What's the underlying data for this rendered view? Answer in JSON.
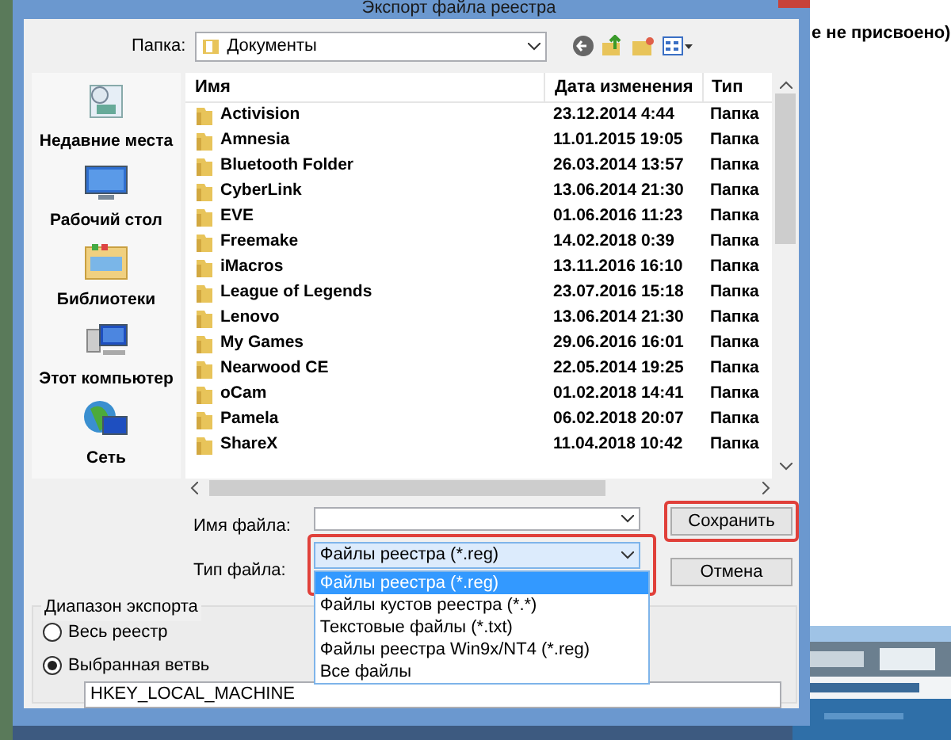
{
  "window": {
    "title": "Экспорт файла реестра"
  },
  "background_window": {
    "text": "е не присвоено)"
  },
  "folder": {
    "label": "Папка:",
    "value": "Документы"
  },
  "places": [
    {
      "kind": "recent",
      "label": "Недавние места"
    },
    {
      "kind": "desktop",
      "label": "Рабочий стол"
    },
    {
      "kind": "libraries",
      "label": "Библиотеки"
    },
    {
      "kind": "computer",
      "label": "Этот компьютер"
    },
    {
      "kind": "network",
      "label": "Сеть"
    }
  ],
  "table": {
    "columns": [
      "Имя",
      "Дата изменения",
      "Тип"
    ],
    "rows": [
      [
        "Activision",
        "23.12.2014 4:44",
        "Папка"
      ],
      [
        "Amnesia",
        "11.01.2015 19:05",
        "Папка"
      ],
      [
        "Bluetooth Folder",
        "26.03.2014 13:57",
        "Папка"
      ],
      [
        "CyberLink",
        "13.06.2014 21:30",
        "Папка"
      ],
      [
        "EVE",
        "01.06.2016 11:23",
        "Папка"
      ],
      [
        "Freemake",
        "14.02.2018 0:39",
        "Папка"
      ],
      [
        "iMacros",
        "13.11.2016 16:10",
        "Папка"
      ],
      [
        "League of Legends",
        "23.07.2016 15:18",
        "Папка"
      ],
      [
        "Lenovo",
        "13.06.2014 21:30",
        "Папка"
      ],
      [
        "My Games",
        "29.06.2016 16:01",
        "Папка"
      ],
      [
        "Nearwood CE",
        "22.05.2014 19:25",
        "Папка"
      ],
      [
        "oCam",
        "01.02.2018 14:41",
        "Папка"
      ],
      [
        "Pamela",
        "06.02.2018 20:07",
        "Папка"
      ],
      [
        "ShareX",
        "11.04.2018 10:42",
        "Папка"
      ]
    ]
  },
  "file_name": {
    "label": "Имя файла:"
  },
  "file_type": {
    "label": "Тип файла:",
    "value": "Файлы реестра (*.reg)",
    "highlighted": true
  },
  "file_type_options": [
    {
      "label": "Файлы реестра (*.reg)",
      "selected": true
    },
    {
      "label": "Файлы кустов реестра (*.*)",
      "selected": false
    },
    {
      "label": "Текстовые файлы (*.txt)",
      "selected": false
    },
    {
      "label": "Файлы реестра Win9x/NT4 (*.reg)",
      "selected": false
    },
    {
      "label": "Все файлы",
      "selected": false
    }
  ],
  "buttons": [
    {
      "label": "Сохранить",
      "highlighted": true
    },
    {
      "label": "Отмена",
      "highlighted": false
    }
  ],
  "export_range": {
    "title": "Диапазон экспорта",
    "options": [
      {
        "label": "Весь реестр",
        "selected": false
      },
      {
        "label": "Выбранная ветвь",
        "selected": true
      }
    ],
    "branch": "HKEY_LOCAL_MACHINE"
  }
}
